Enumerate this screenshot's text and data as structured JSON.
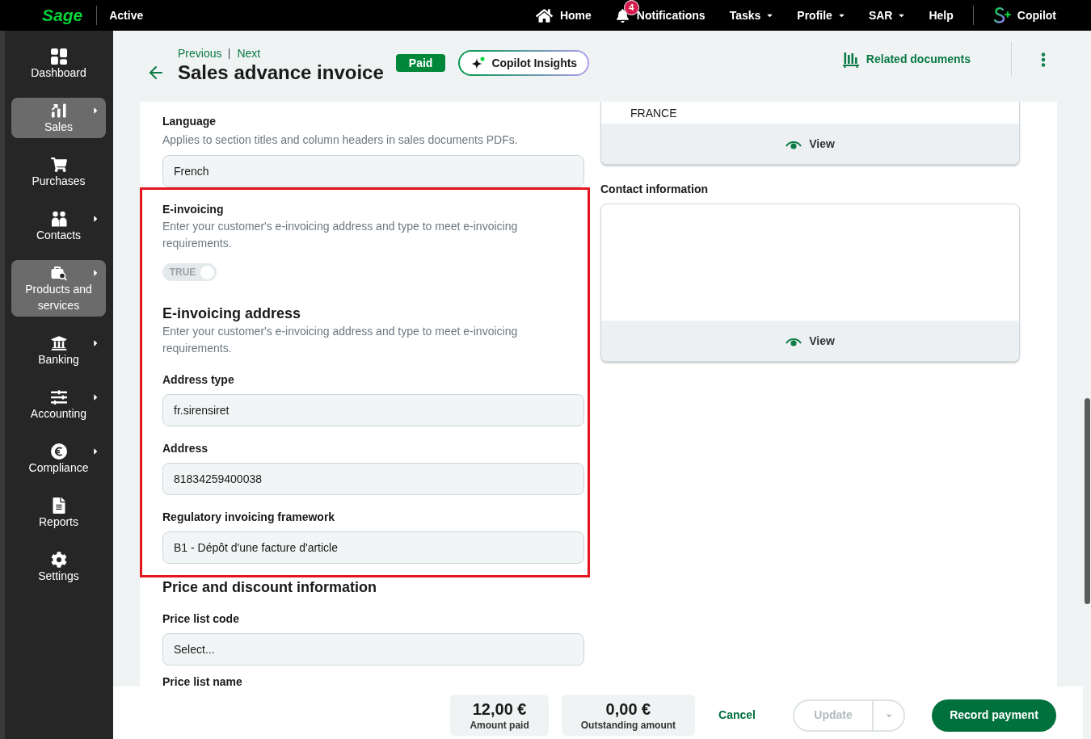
{
  "top_bar": {
    "brand": "Sage",
    "status": "Active",
    "home": "Home",
    "notifications": {
      "label": "Notifications",
      "count": "4"
    },
    "menus": [
      {
        "label": "Tasks"
      },
      {
        "label": "Profile"
      },
      {
        "label": "SAR"
      }
    ],
    "help": "Help",
    "copilot": "Copilot"
  },
  "sidebar": {
    "items": [
      {
        "label": "Dashboard",
        "selected": false,
        "has_submenu": false
      },
      {
        "label": "Sales",
        "selected": true,
        "has_submenu": true
      },
      {
        "label": "Purchases",
        "selected": false,
        "has_submenu": false
      },
      {
        "label": "Contacts",
        "selected": false,
        "has_submenu": true
      },
      {
        "label": "Products and services",
        "selected": true,
        "has_submenu": true
      },
      {
        "label": "Banking",
        "selected": false,
        "has_submenu": true
      },
      {
        "label": "Accounting",
        "selected": false,
        "has_submenu": true
      },
      {
        "label": "Compliance",
        "selected": false,
        "has_submenu": true
      },
      {
        "label": "Reports",
        "selected": false,
        "has_submenu": false
      },
      {
        "label": "Settings",
        "selected": false,
        "has_submenu": false
      }
    ]
  },
  "header": {
    "previous": "Previous",
    "next": "Next",
    "title": "Sales advance invoice",
    "status": "Paid",
    "insights_button": "Copilot Insights",
    "related_documents": "Related documents"
  },
  "form": {
    "language": {
      "label": "Language",
      "description": "Applies to section titles and column headers in sales documents PDFs.",
      "value": "French"
    },
    "e_invoicing": {
      "label": "E-invoicing",
      "description": "Enter your customer's e-invoicing address and type to meet e-invoicing requirements.",
      "toggle": {
        "label": "TRUE",
        "on": true,
        "disabled": true
      },
      "address_heading": "E-invoicing address",
      "address_description": "Enter your customer's e-invoicing address and type to meet e-invoicing requirements.",
      "fields": [
        {
          "label": "Address type",
          "value": "fr.sirensiret"
        },
        {
          "label": "Address",
          "value": "81834259400038"
        },
        {
          "label": "Regulatory invoicing framework",
          "value": "B1 - Dépôt d'une facture d'article"
        }
      ]
    },
    "price_discount": {
      "heading": "Price and discount information",
      "fields": [
        {
          "label": "Price list code",
          "placeholder": "Select..."
        }
      ],
      "next_label": "Price list name"
    }
  },
  "side_panels": {
    "address": {
      "country": "FRANCE",
      "action": "View"
    },
    "contact": {
      "heading": "Contact information",
      "action": "View"
    }
  },
  "footer": {
    "amounts": [
      {
        "value": "12,00 €",
        "label": "Amount paid"
      },
      {
        "value": "0,00 €",
        "label": "Outstanding amount"
      }
    ],
    "cancel": "Cancel",
    "update": {
      "label": "Update",
      "disabled": true
    },
    "primary": "Record payment"
  }
}
